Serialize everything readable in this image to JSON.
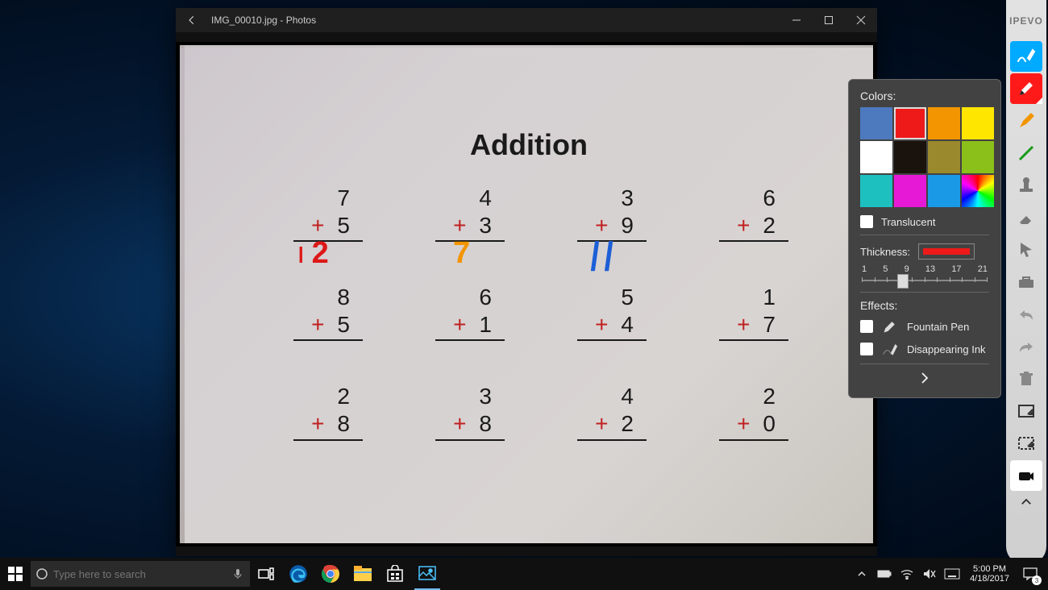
{
  "photos": {
    "title": "IMG_00010.jpg - Photos"
  },
  "worksheet": {
    "title": "Addition",
    "rows": [
      [
        {
          "a": "7",
          "b": "5",
          "ans": "12",
          "ans_color": "red"
        },
        {
          "a": "4",
          "b": "3",
          "ans": "7",
          "ans_color": "orange"
        },
        {
          "a": "3",
          "b": "9",
          "ans": "11",
          "ans_color": "blue"
        },
        {
          "a": "6",
          "b": "2"
        }
      ],
      [
        {
          "a": "8",
          "b": "5"
        },
        {
          "a": "6",
          "b": "1"
        },
        {
          "a": "5",
          "b": "4"
        },
        {
          "a": "1",
          "b": "7"
        }
      ],
      [
        {
          "a": "2",
          "b": "8"
        },
        {
          "a": "3",
          "b": "8"
        },
        {
          "a": "4",
          "b": "2"
        },
        {
          "a": "2",
          "b": "0"
        }
      ]
    ]
  },
  "ipevo": {
    "logo": "IPEVO"
  },
  "panel": {
    "colors_label": "Colors:",
    "translucent_label": "Translucent",
    "thickness_label": "Thickness:",
    "ticks": [
      "1",
      "5",
      "9",
      "13",
      "17",
      "21"
    ],
    "effects_label": "Effects:",
    "effects": {
      "fountain": "Fountain Pen",
      "disappearing": "Disappearing Ink"
    },
    "swatches": [
      "#4d79bf",
      "#ee1a1a",
      "#f29500",
      "#ffe600",
      "#ffffff",
      "#1a120d",
      "#9a8a2d",
      "#8bbf1a",
      "#1ebfbf",
      "#e61ad6",
      "#1a9ae6",
      "rainbow"
    ],
    "selected_swatch": 1
  },
  "search": {
    "placeholder": "Type here to search"
  },
  "clock": {
    "time": "5:00 PM",
    "date": "4/18/2017"
  },
  "notif": {
    "count": "3"
  }
}
